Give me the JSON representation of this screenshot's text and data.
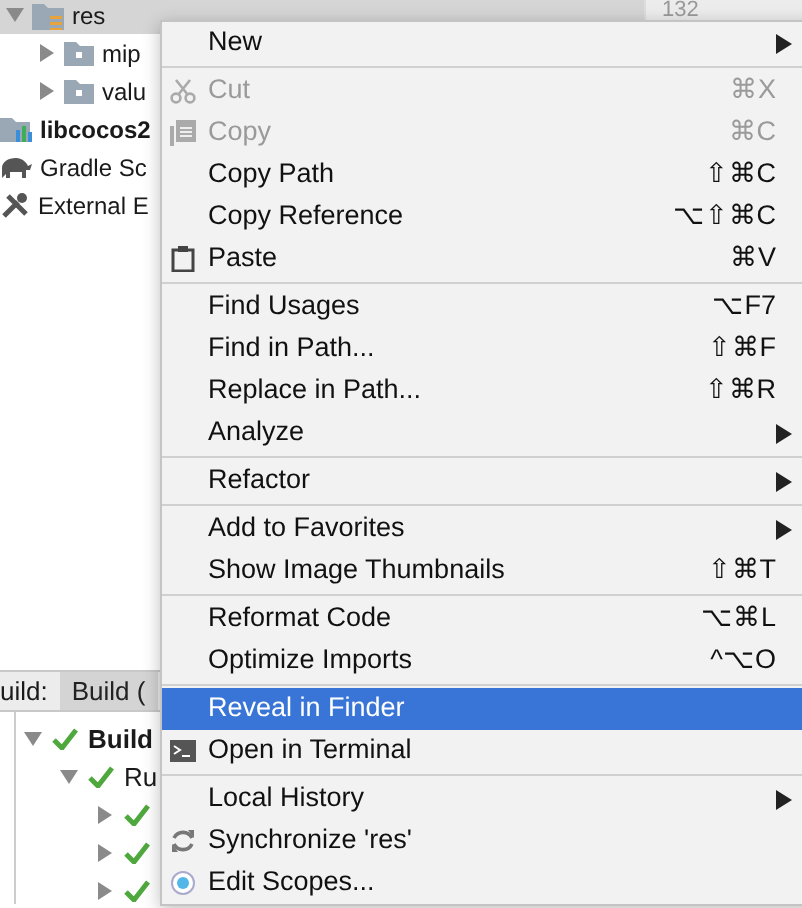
{
  "project_tree": [
    {
      "label": "res",
      "expanded": true,
      "bold": false,
      "kind": "res-folder",
      "selected": true,
      "children": [
        {
          "label": "mip",
          "expanded": false,
          "bold": false,
          "kind": "folder",
          "selected": false
        },
        {
          "label": "valu",
          "expanded": false,
          "bold": false,
          "kind": "folder",
          "selected": false
        }
      ]
    },
    {
      "label": "libcocos2",
      "bold": true,
      "kind": "module",
      "selected": false
    },
    {
      "label": "Gradle Sc",
      "bold": false,
      "kind": "gradle",
      "selected": false
    },
    {
      "label": "External E",
      "bold": false,
      "kind": "tools",
      "selected": false
    }
  ],
  "gutter": {
    "line_number": "132"
  },
  "build_panel": {
    "title": "uild:",
    "tabs": [
      {
        "label": "Build (",
        "selected": true
      }
    ],
    "tree": [
      {
        "label": "Build",
        "bold": true,
        "expanded": true,
        "children": [
          {
            "label": "Ru",
            "bold": false,
            "expanded": true,
            "children": [
              {
                "expanded": false
              },
              {
                "expanded": false
              },
              {
                "expanded": false
              }
            ]
          }
        ]
      }
    ]
  },
  "context_menu": {
    "groups": [
      [
        {
          "label": "New",
          "submenu": true,
          "disabled": false,
          "selected": false,
          "kind": "plain"
        }
      ],
      [
        {
          "label": "Cut",
          "shortcut": "⌘X",
          "submenu": false,
          "disabled": true,
          "selected": false,
          "kind": "scissors"
        },
        {
          "label": "Copy",
          "shortcut": "⌘C",
          "submenu": false,
          "disabled": true,
          "selected": false,
          "kind": "copy"
        },
        {
          "label": "Copy Path",
          "shortcut": "⇧⌘C",
          "submenu": false,
          "disabled": false,
          "selected": false,
          "kind": "plain"
        },
        {
          "label": "Copy Reference",
          "shortcut": "⌥⇧⌘C",
          "submenu": false,
          "disabled": false,
          "selected": false,
          "kind": "plain"
        },
        {
          "label": "Paste",
          "shortcut": "⌘V",
          "submenu": false,
          "disabled": false,
          "selected": false,
          "kind": "clipboard"
        }
      ],
      [
        {
          "label": "Find Usages",
          "shortcut": "⌥F7",
          "submenu": false,
          "disabled": false,
          "selected": false,
          "kind": "plain"
        },
        {
          "label": "Find in Path...",
          "shortcut": "⇧⌘F",
          "submenu": false,
          "disabled": false,
          "selected": false,
          "kind": "plain"
        },
        {
          "label": "Replace in Path...",
          "shortcut": "⇧⌘R",
          "submenu": false,
          "disabled": false,
          "selected": false,
          "kind": "plain"
        },
        {
          "label": "Analyze",
          "submenu": true,
          "disabled": false,
          "selected": false,
          "kind": "plain"
        }
      ],
      [
        {
          "label": "Refactor",
          "submenu": true,
          "disabled": false,
          "selected": false,
          "kind": "plain"
        }
      ],
      [
        {
          "label": "Add to Favorites",
          "submenu": true,
          "disabled": false,
          "selected": false,
          "kind": "plain"
        },
        {
          "label": "Show Image Thumbnails",
          "shortcut": "⇧⌘T",
          "submenu": false,
          "disabled": false,
          "selected": false,
          "kind": "plain"
        }
      ],
      [
        {
          "label": "Reformat Code",
          "shortcut": "⌥⌘L",
          "submenu": false,
          "disabled": false,
          "selected": false,
          "kind": "plain"
        },
        {
          "label": "Optimize Imports",
          "shortcut": "^⌥O",
          "submenu": false,
          "disabled": false,
          "selected": false,
          "kind": "plain"
        }
      ],
      [
        {
          "label": "Reveal in Finder",
          "submenu": false,
          "disabled": false,
          "selected": true,
          "kind": "plain"
        },
        {
          "label": "Open in Terminal",
          "submenu": false,
          "disabled": false,
          "selected": false,
          "kind": "terminal"
        }
      ],
      [
        {
          "label": "Local History",
          "submenu": true,
          "disabled": false,
          "selected": false,
          "kind": "plain"
        },
        {
          "label": "Synchronize 'res'",
          "submenu": false,
          "disabled": false,
          "selected": false,
          "kind": "sync"
        },
        {
          "label": "Edit Scopes...",
          "submenu": false,
          "disabled": false,
          "selected": false,
          "kind": "scope"
        }
      ]
    ]
  }
}
